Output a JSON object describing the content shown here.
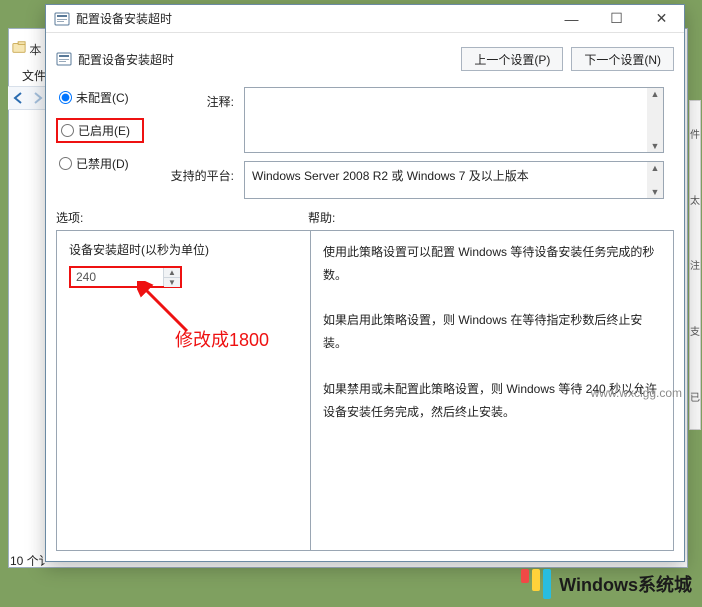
{
  "background": {
    "menu_file": "文件",
    "tab_icon_label": "本",
    "count_text": "10 个讠"
  },
  "dialog": {
    "title": "配置设备安装超时",
    "subtitle": "配置设备安装超时",
    "nav": {
      "prev": "上一个设置(P)",
      "next": "下一个设置(N)"
    },
    "state": {
      "not_configured": "未配置(C)",
      "enabled": "已启用(E)",
      "disabled": "已禁用(D)",
      "selected": "not_configured"
    },
    "comment": {
      "label": "注释:",
      "text": ""
    },
    "platform": {
      "label": "支持的平台:",
      "text": "Windows Server 2008 R2 或 Windows 7 及以上版本"
    },
    "sections": {
      "options": "选项:",
      "help": "帮助:"
    },
    "options": {
      "timeout_label": "设备安装超时(以秒为单位)",
      "timeout_value": "240"
    },
    "help": {
      "p1": "使用此策略设置可以配置 Windows 等待设备安装任务完成的秒数。",
      "p2": "如果启用此策略设置，则 Windows 在等待指定秒数后终止安装。",
      "p3": "如果禁用或未配置此策略设置，则 Windows 等待 240 秒以允许设备安装任务完成，然后终止安装。"
    }
  },
  "annotation": {
    "text": "修改成1800"
  },
  "side_items": [
    "件",
    "太",
    "注",
    "支",
    "已"
  ],
  "watermark": {
    "brand": "Windows系统城",
    "url": "www.wxclgg.com"
  }
}
